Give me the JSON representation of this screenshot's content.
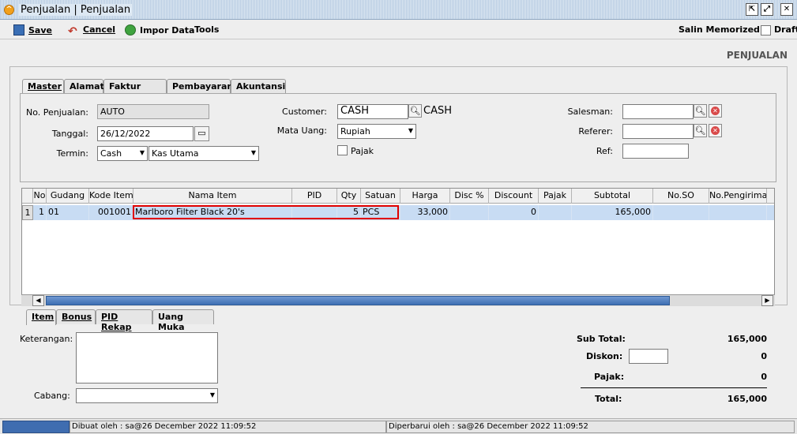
{
  "window": {
    "title": "Penjualan | Penjualan"
  },
  "toolbar": {
    "save": "Save",
    "cancel": "Cancel",
    "import": "Impor Data",
    "tools": "Tools",
    "memorized": "Salin Memorized",
    "draft": "Draft"
  },
  "page_heading": "PENJUALAN",
  "tabs": [
    "Master",
    "Alamat",
    "Faktur Pajak",
    "Pembayaran",
    "Akuntansi"
  ],
  "master": {
    "no_penjualan_label": "No. Penjualan:",
    "no_penjualan": "AUTO",
    "tanggal_label": "Tanggal:",
    "tanggal": "26/12/2022",
    "termin_label": "Termin:",
    "termin": "Cash",
    "kas": "Kas Utama",
    "customer_label": "Customer:",
    "customer": "CASH",
    "customer_name": "CASH",
    "mata_uang_label": "Mata Uang:",
    "mata_uang": "Rupiah",
    "pajak_label": "Pajak",
    "salesman_label": "Salesman:",
    "referer_label": "Referer:",
    "ref_label": "Ref:"
  },
  "grid": {
    "columns": [
      "No",
      "Gudang",
      "Kode Item",
      "Nama Item",
      "PID",
      "Qty",
      "Satuan",
      "Harga",
      "Disc %",
      "Discount",
      "Pajak",
      "Subtotal",
      "No.SO",
      "No.Pengiriman"
    ],
    "rows": [
      {
        "idx": "1",
        "no": "1",
        "gudang": "01",
        "kode": "001001",
        "nama": "Marlboro Filter Black 20's",
        "pid": "",
        "qty": "5",
        "satuan": "PCS",
        "harga": "33,000",
        "disc": "",
        "discount": "0",
        "pajak": "",
        "subtotal": "165,000",
        "so": "",
        "pengiriman": ""
      }
    ]
  },
  "bottom_tabs": [
    "Item",
    "Bonus",
    "PID Rekap",
    "Uang Muka"
  ],
  "footer": {
    "keterangan_label": "Keterangan:",
    "cabang_label": "Cabang:"
  },
  "totals": {
    "subtotal_label": "Sub Total:",
    "subtotal": "165,000",
    "diskon_label": "Diskon:",
    "diskon": "0",
    "pajak_label": "Pajak:",
    "pajak": "0",
    "total_label": "Total:",
    "total": "165,000"
  },
  "status": {
    "created": "Dibuat oleh : sa@26 December 2022  11:09:52",
    "updated": "Diperbarui oleh : sa@26 December 2022  11:09:52"
  },
  "colors": {
    "selected_row": "#c8dcf3",
    "highlight_box": "#e00000",
    "scroll_thumb": "#3e6fb3"
  }
}
